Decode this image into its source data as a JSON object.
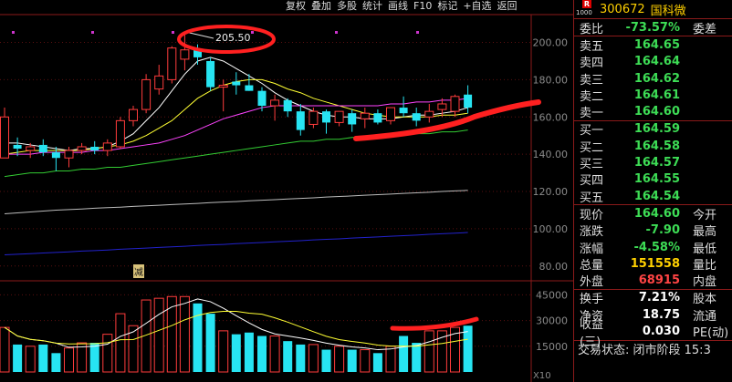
{
  "toolbar": {
    "items": [
      "复权",
      "叠加",
      "多股",
      "统计",
      "画线",
      "F10",
      "标记",
      "+自选",
      "返回"
    ]
  },
  "quote": {
    "badge": "R",
    "market_code": "1000",
    "code": "300672",
    "name": "国科微",
    "weibi_label": "委比",
    "weibi_value": "-73.57%",
    "weicha_label": "委差",
    "asks": [
      {
        "label": "卖五",
        "price": "164.65"
      },
      {
        "label": "卖四",
        "price": "164.64"
      },
      {
        "label": "卖三",
        "price": "164.62"
      },
      {
        "label": "卖二",
        "price": "164.61"
      },
      {
        "label": "卖一",
        "price": "164.60"
      }
    ],
    "bids": [
      {
        "label": "买一",
        "price": "164.59"
      },
      {
        "label": "买二",
        "price": "164.58"
      },
      {
        "label": "买三",
        "price": "164.57"
      },
      {
        "label": "买四",
        "price": "164.55"
      },
      {
        "label": "买五",
        "price": "164.54"
      }
    ],
    "stats": [
      {
        "label": "现价",
        "value": "164.60",
        "color": "#3ddc55",
        "label2": "今开"
      },
      {
        "label": "涨跌",
        "value": "-7.90",
        "color": "#3ddc55",
        "label2": "最高"
      },
      {
        "label": "涨幅",
        "value": "-4.58%",
        "color": "#3ddc55",
        "label2": "最低"
      },
      {
        "label": "总量",
        "value": "151558",
        "color": "#ffd000",
        "label2": "量比"
      },
      {
        "label": "外盘",
        "value": "68915",
        "color": "#ff4444",
        "label2": "内盘"
      }
    ],
    "stats2": [
      {
        "label": "换手",
        "value": "7.21%",
        "color": "#ffffff",
        "label2": "股本"
      },
      {
        "label": "净资",
        "value": "18.75",
        "color": "#ffffff",
        "label2": "流通"
      },
      {
        "label": "收益(三)",
        "value": "0.030",
        "color": "#ffffff",
        "label2": "PE(动)"
      }
    ],
    "status": "交易状态: 闭市阶段 15:3"
  },
  "chart": {
    "price_axis_ticks": [
      "200.00",
      "180.00",
      "160.00",
      "140.00",
      "120.00",
      "100.00",
      "80.00"
    ],
    "volume_axis_ticks": [
      "45000",
      "30000",
      "15000"
    ],
    "volume_unit": "X10",
    "high_label": "205.50",
    "reduce_marker": "减"
  },
  "chart_data": {
    "type": "candlestick",
    "ylim": [
      75,
      212
    ],
    "volume_ylim": [
      0,
      50000
    ],
    "candles": [
      {
        "o": 138,
        "h": 165,
        "l": 140,
        "c": 160,
        "v": 26000
      },
      {
        "o": 145,
        "h": 149,
        "l": 139,
        "c": 143,
        "v": 16000
      },
      {
        "o": 142,
        "h": 146,
        "l": 138,
        "c": 144,
        "v": 15000
      },
      {
        "o": 145,
        "h": 148,
        "l": 139,
        "c": 141,
        "v": 16000
      },
      {
        "o": 141,
        "h": 144,
        "l": 131,
        "c": 138,
        "v": 11000
      },
      {
        "o": 138,
        "h": 144,
        "l": 133,
        "c": 142,
        "v": 14000
      },
      {
        "o": 142,
        "h": 146,
        "l": 140,
        "c": 144,
        "v": 17000
      },
      {
        "o": 144,
        "h": 147,
        "l": 140,
        "c": 142,
        "v": 17000
      },
      {
        "o": 142,
        "h": 148,
        "l": 139,
        "c": 146,
        "v": 22000
      },
      {
        "o": 144,
        "h": 160,
        "l": 143,
        "c": 158,
        "v": 34000
      },
      {
        "o": 158,
        "h": 166,
        "l": 155,
        "c": 164,
        "v": 27000
      },
      {
        "o": 164,
        "h": 183,
        "l": 162,
        "c": 180,
        "v": 42000
      },
      {
        "o": 175,
        "h": 188,
        "l": 172,
        "c": 182,
        "v": 43000
      },
      {
        "o": 180,
        "h": 198,
        "l": 178,
        "c": 197,
        "v": 44000
      },
      {
        "o": 191,
        "h": 205.5,
        "l": 185,
        "c": 196,
        "v": 44000
      },
      {
        "o": 196,
        "h": 199,
        "l": 188,
        "c": 192,
        "v": 40000
      },
      {
        "o": 190,
        "h": 192,
        "l": 174,
        "c": 176,
        "v": 34000
      },
      {
        "o": 176,
        "h": 180,
        "l": 163,
        "c": 177,
        "v": 24000
      },
      {
        "o": 179,
        "h": 184,
        "l": 172,
        "c": 177,
        "v": 22000
      },
      {
        "o": 177,
        "h": 183,
        "l": 174,
        "c": 174,
        "v": 23000
      },
      {
        "o": 174,
        "h": 176,
        "l": 163,
        "c": 166,
        "v": 21000
      },
      {
        "o": 166,
        "h": 172,
        "l": 158,
        "c": 169,
        "v": 21000
      },
      {
        "o": 169,
        "h": 170,
        "l": 160,
        "c": 163,
        "v": 18000
      },
      {
        "o": 163,
        "h": 167,
        "l": 150,
        "c": 153,
        "v": 16000
      },
      {
        "o": 156,
        "h": 165,
        "l": 154,
        "c": 163,
        "v": 16000
      },
      {
        "o": 163,
        "h": 164,
        "l": 151,
        "c": 157,
        "v": 13000
      },
      {
        "o": 157,
        "h": 163,
        "l": 155,
        "c": 163,
        "v": 15000
      },
      {
        "o": 162,
        "h": 164,
        "l": 152,
        "c": 156,
        "v": 13000
      },
      {
        "o": 159,
        "h": 165,
        "l": 154,
        "c": 162,
        "v": 13000
      },
      {
        "o": 162,
        "h": 164,
        "l": 156,
        "c": 157,
        "v": 11000
      },
      {
        "o": 158,
        "h": 165,
        "l": 156,
        "c": 165,
        "v": 15000
      },
      {
        "o": 165,
        "h": 171,
        "l": 160,
        "c": 162,
        "v": 21000
      },
      {
        "o": 162,
        "h": 165,
        "l": 155,
        "c": 158,
        "v": 17000
      },
      {
        "o": 160,
        "h": 167,
        "l": 157,
        "c": 163,
        "v": 24000
      },
      {
        "o": 164,
        "h": 170,
        "l": 160,
        "c": 167,
        "v": 24000
      },
      {
        "o": 163,
        "h": 172,
        "l": 160,
        "c": 171,
        "v": 26000
      },
      {
        "o": 172,
        "h": 177,
        "l": 162,
        "c": 165,
        "v": 27000
      }
    ],
    "ma_lines": [
      {
        "color": "#ffffff",
        "values": [
          146,
          146,
          145,
          144,
          143,
          142,
          143,
          143,
          144,
          147,
          151,
          158,
          165,
          174,
          183,
          190,
          192,
          190,
          186,
          182,
          178,
          173,
          169,
          166,
          163,
          161,
          160,
          160,
          159,
          159,
          159,
          160,
          161,
          161,
          162,
          163,
          165
        ]
      },
      {
        "color": "#ffff33",
        "values": [
          140,
          141,
          142,
          142,
          142,
          142,
          142,
          143,
          144,
          145,
          147,
          150,
          154,
          158,
          164,
          170,
          174,
          177,
          179,
          180,
          180,
          178,
          175,
          173,
          170,
          168,
          166,
          164,
          162,
          161,
          160,
          160,
          160,
          160,
          161,
          161,
          162
        ]
      },
      {
        "color": "#ff44ff",
        "values": [
          140,
          140,
          140,
          141,
          141,
          141,
          141,
          142,
          142,
          143,
          144,
          145,
          146,
          148,
          150,
          153,
          156,
          159,
          161,
          163,
          165,
          166,
          166,
          166,
          166,
          166,
          166,
          166,
          166,
          166,
          167,
          167,
          168,
          168,
          169,
          169,
          170
        ]
      },
      {
        "color": "#33cc33",
        "values": [
          128,
          129,
          130,
          130,
          131,
          131,
          132,
          132,
          133,
          133,
          134,
          135,
          136,
          137,
          138,
          139,
          140,
          141,
          142,
          143,
          144,
          145,
          146,
          147,
          147,
          148,
          148,
          149,
          149,
          150,
          150,
          150,
          151,
          151,
          152,
          152,
          153
        ]
      },
      {
        "color": "#bbbbbb",
        "values": [
          108,
          108.5,
          109,
          109.5,
          110,
          110.3,
          110.6,
          111,
          111.3,
          111.6,
          112,
          112.3,
          112.6,
          113,
          113.3,
          113.6,
          114,
          114.3,
          114.6,
          115,
          115.3,
          115.6,
          116,
          116.3,
          116.6,
          117,
          117.3,
          117.6,
          118,
          118.3,
          118.6,
          119,
          119.3,
          119.6,
          120,
          120.3,
          120.6
        ]
      },
      {
        "color": "#2222cc",
        "values": [
          86,
          86.3,
          86.6,
          87,
          87.3,
          87.6,
          88,
          88.3,
          88.6,
          89,
          89.3,
          89.6,
          90,
          90.3,
          90.6,
          91,
          91.3,
          91.6,
          92,
          92.3,
          92.6,
          93,
          93.3,
          93.6,
          94,
          94.3,
          94.6,
          95,
          95.3,
          95.6,
          96,
          96.3,
          96.6,
          97,
          97.3,
          97.6,
          98
        ]
      }
    ]
  }
}
